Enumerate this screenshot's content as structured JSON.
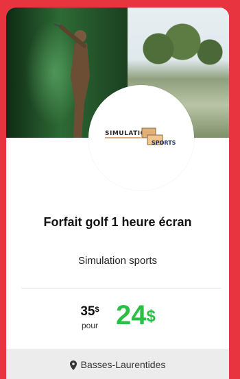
{
  "offer": {
    "title": "Forfait golf 1 heure écran",
    "vendor": "Simulation sports",
    "logo_text_top": "SIMULATION",
    "logo_text_bottom": "SPORTS",
    "original_price": "35",
    "original_currency": "$",
    "pour_label": "pour",
    "deal_price": "24",
    "deal_currency": "$",
    "region": "Basses-Laurentides",
    "region_icon": "map-pin-icon"
  },
  "colors": {
    "background_accent": "#e8343f",
    "deal_price": "#2bbf46"
  }
}
